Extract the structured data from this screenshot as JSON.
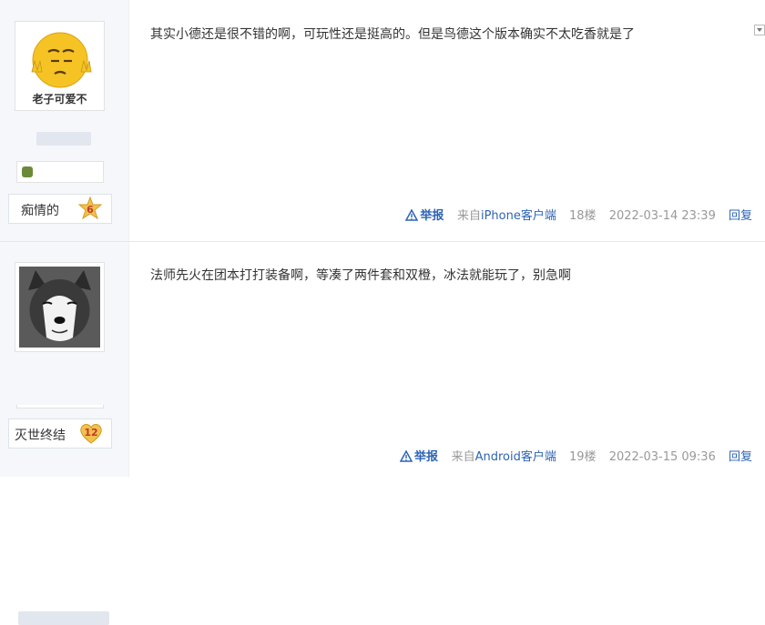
{
  "posts": [
    {
      "avatar_caption": "老子可爱不",
      "rank_title": "痴情的",
      "level": "6",
      "content": "其实小德还是很不错的啊，可玩性还是挺高的。但是鸟德这个版本确实不太吃香就是了",
      "report_label": "举报",
      "source_prefix": "来自",
      "source_client": "iPhone客户端",
      "floor": "18楼",
      "time": "2022-03-14 23:39",
      "reply_label": "回复"
    },
    {
      "rank_title": "灭世终结",
      "level": "12",
      "content": "法师先火在团本打打装备啊，等凑了两件套和双橙，冰法就能玩了，别急啊",
      "report_label": "举报",
      "source_prefix": "来自",
      "source_client": "Android客户端",
      "floor": "19楼",
      "time": "2022-03-15 09:36",
      "reply_label": "回复"
    }
  ],
  "colors": {
    "link": "#2d64b3",
    "meta": "#999999",
    "sidebar": "#f5f7fa",
    "badge": "#f2c14e"
  },
  "icons": {
    "report": "warning-triangle-icon",
    "collapse": "chevron-down-icon"
  }
}
